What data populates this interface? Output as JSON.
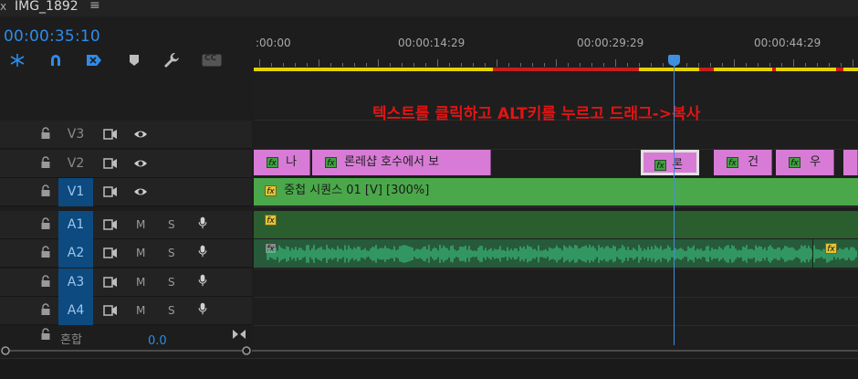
{
  "tab": {
    "close": "x",
    "title": "IMG_1892",
    "menu": "≡"
  },
  "timecode": "00:00:35:10",
  "toolbar": {
    "tools": [
      "snap-ripple-icon",
      "magnet-icon",
      "linked-selection-icon",
      "marker-icon",
      "wrench-icon",
      "captions-icon"
    ],
    "captions_label": "CC"
  },
  "ruler": {
    "labels": [
      ":00:00",
      "00:00:14:29",
      "00:00:29:29",
      "00:00:44:29"
    ]
  },
  "annotation": "텍스트를 클릭하고 ALT키를 누르고 드래그->복사",
  "tracks": [
    {
      "name": "V3",
      "type": "video",
      "targeted": false
    },
    {
      "name": "V2",
      "type": "video",
      "targeted": false
    },
    {
      "name": "V1",
      "type": "video",
      "targeted": true
    },
    {
      "name": "A1",
      "type": "audio",
      "targeted": true
    },
    {
      "name": "A2",
      "type": "audio",
      "targeted": true
    },
    {
      "name": "A3",
      "type": "audio",
      "targeted": true
    },
    {
      "name": "A4",
      "type": "audio",
      "targeted": true
    }
  ],
  "audio_buttons": {
    "mute": "M",
    "solo": "S"
  },
  "mix": {
    "label": "혼합",
    "value": "0.0"
  },
  "clips": {
    "v2": [
      {
        "text": "나",
        "fx": "fx"
      },
      {
        "text": "론레샵 호수에서 보",
        "fx": "fx"
      },
      {
        "text": "론",
        "fx": "fx"
      },
      {
        "text": "건",
        "fx": "fx"
      },
      {
        "text": "우",
        "fx": "fx"
      }
    ],
    "v1": {
      "text": "중첩 시퀀스 01 [V] [300%]",
      "fx": "fx"
    },
    "a1": {
      "fx": "fx"
    },
    "a2": {
      "fx": "fx"
    }
  },
  "colors": {
    "accent": "#2d8ceb",
    "pink_clip": "#d87bd6",
    "green_clip": "#4aa84a",
    "workarea": "#e6d200",
    "annotation": "#e21414"
  }
}
